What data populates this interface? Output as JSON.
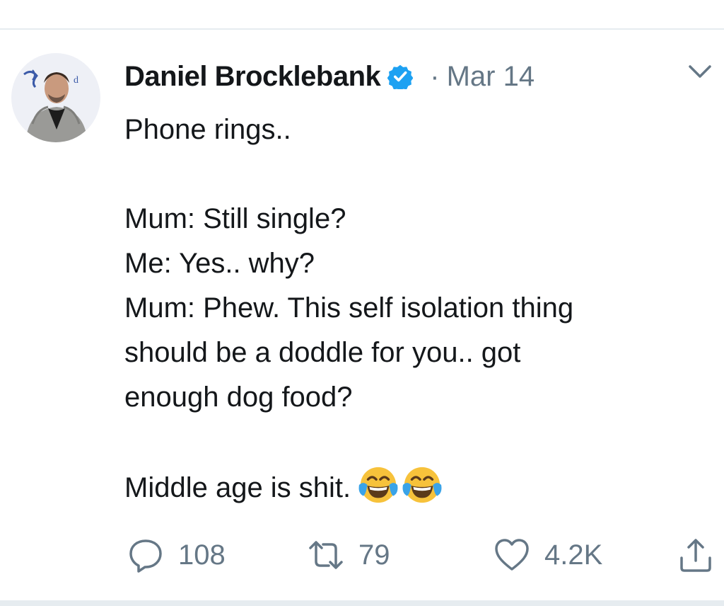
{
  "author": {
    "name": "Daniel Brocklebank",
    "verified": true,
    "separator": "·",
    "date": "Mar 14",
    "avatar_icon": "profile-photo"
  },
  "tweet": {
    "text": "Phone rings..\n\nMum: Still single?\nMe: Yes.. why?\nMum: Phew. This self isolation thing\nshould be a doddle for you.. got\nenough dog food?\n\nMiddle age is shit.",
    "emojis": [
      "face-with-tears-of-joy",
      "face-with-tears-of-joy"
    ]
  },
  "actions": {
    "reply": {
      "icon": "reply-icon",
      "count": "108"
    },
    "retweet": {
      "icon": "retweet-icon",
      "count": "79"
    },
    "like": {
      "icon": "heart-icon",
      "count": "4.2K"
    },
    "share": {
      "icon": "share-icon"
    }
  },
  "colors": {
    "text": "#14171a",
    "secondary": "#657786",
    "verified": "#1da1f2",
    "divider": "#e6ecf0"
  }
}
